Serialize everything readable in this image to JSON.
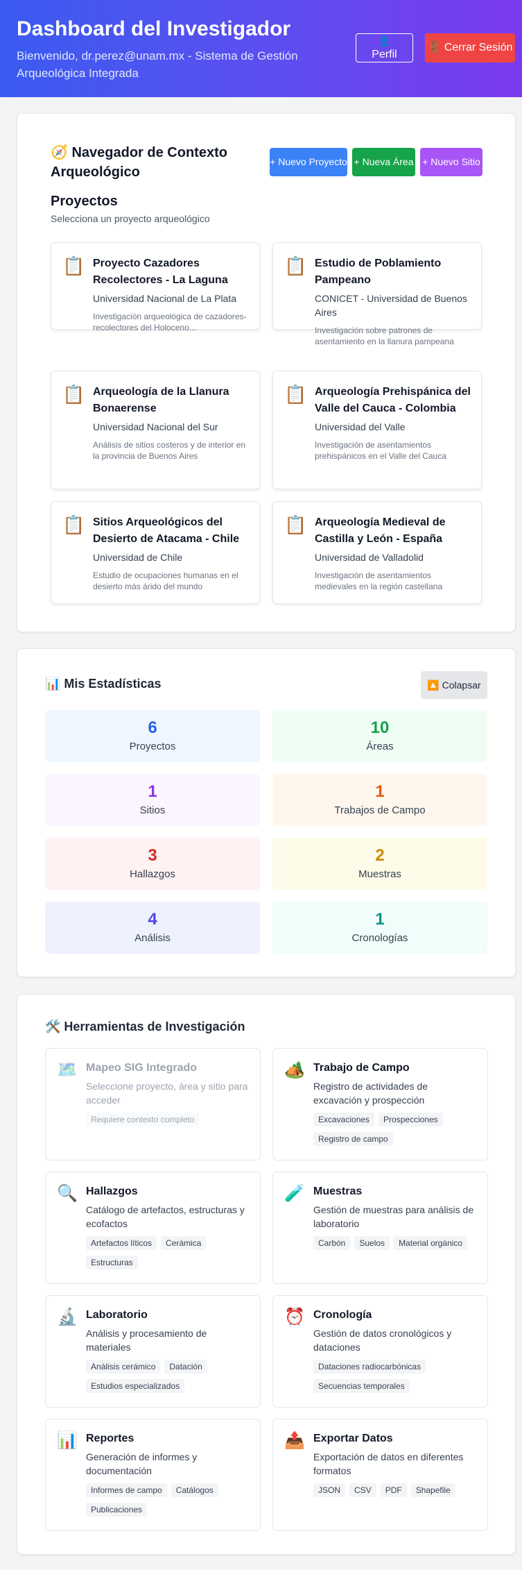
{
  "header": {
    "title": "Dashboard del Investigador",
    "subtitle": "Bienvenido, dr.perez@unam.mx - Sistema de Gestión Arqueológica Integrada",
    "profile_icon": "👤",
    "profile_label": "Perfil",
    "logout_icon": "🚪",
    "logout_label": "Cerrar Sesión"
  },
  "navigator": {
    "title": "🧭 Navegador de Contexto Arqueológico",
    "new_project": "+ Nuevo Proyecto",
    "new_area": "+ Nueva Área",
    "new_site": "+ Nuevo Sitio",
    "projects_heading": "Proyectos",
    "projects_sub": "Selecciona un proyecto arqueológico",
    "project_icon": "📋",
    "projects": [
      {
        "name": "Proyecto Cazadores Recolectores - La Laguna",
        "institution": "Universidad Nacional de La Plata",
        "description": "Investigación arqueológica de cazadores-recolectores del Holoceno..."
      },
      {
        "name": "Estudio de Poblamiento Pampeano",
        "institution": "CONICET - Universidad de Buenos Aires",
        "description": "Investigación sobre patrones de asentamiento en la llanura pampeana"
      },
      {
        "name": "Arqueología de la Llanura Bonaerense",
        "institution": "Universidad Nacional del Sur",
        "description": "Análisis de sitios costeros y de interior en la provincia de Buenos Aires"
      },
      {
        "name": "Arqueología Prehispánica del Valle del Cauca - Colombia",
        "institution": "Universidad del Valle",
        "description": "Investigación de asentamientos prehispánicos en el Valle del Cauca"
      },
      {
        "name": "Sitios Arqueológicos del Desierto de Atacama - Chile",
        "institution": "Universidad de Chile",
        "description": "Estudio de ocupaciones humanas en el desierto más árido del mundo"
      },
      {
        "name": "Arqueología Medieval de Castilla y León - España",
        "institution": "Universidad de Valladolid",
        "description": "Investigación de asentamientos medievales en la región castellana"
      }
    ]
  },
  "stats": {
    "title": "📊 Mis Estadísticas",
    "collapse_label": "🔼 Colapsar",
    "items": [
      {
        "value": "6",
        "label": "Proyectos",
        "color": "#2563eb",
        "bg": "#eff6ff"
      },
      {
        "value": "10",
        "label": "Áreas",
        "color": "#16a34a",
        "bg": "#f0fdf4"
      },
      {
        "value": "1",
        "label": "Sitios",
        "color": "#9333ea",
        "bg": "#faf5ff"
      },
      {
        "value": "1",
        "label": "Trabajos de Campo",
        "color": "#ea580c",
        "bg": "#fff7ed"
      },
      {
        "value": "3",
        "label": "Hallazgos",
        "color": "#dc2626",
        "bg": "#fef2f2"
      },
      {
        "value": "2",
        "label": "Muestras",
        "color": "#ca8a04",
        "bg": "#fefce8"
      },
      {
        "value": "4",
        "label": "Análisis",
        "color": "#4f46e5",
        "bg": "#eef2ff"
      },
      {
        "value": "1",
        "label": "Cronologías",
        "color": "#0d9488",
        "bg": "#f0fdfa"
      }
    ]
  },
  "tools": {
    "title": "🛠️ Herramientas de Investigación",
    "items": [
      {
        "icon": "🗺️",
        "name": "Mapeo SIG Integrado",
        "description": "Seleccione proyecto, área y sitio para acceder",
        "tags": [
          "Requiere contexto completo"
        ],
        "disabled": true
      },
      {
        "icon": "🏕️",
        "name": "Trabajo de Campo",
        "description": "Registro de actividades de excavación y prospección",
        "tags": [
          "Excavaciones",
          "Prospecciones",
          "Registro de campo"
        ]
      },
      {
        "icon": "🔍",
        "name": "Hallazgos",
        "description": "Catálogo de artefactos, estructuras y ecofactos",
        "tags": [
          "Artefactos líticos",
          "Cerámica",
          "Estructuras"
        ]
      },
      {
        "icon": "🧪",
        "name": "Muestras",
        "description": "Gestión de muestras para análisis de laboratorio",
        "tags": [
          "Carbón",
          "Suelos",
          "Material orgánico"
        ]
      },
      {
        "icon": "🔬",
        "name": "Laboratorio",
        "description": "Análisis y procesamiento de materiales",
        "tags": [
          "Análisis cerámico",
          "Datación",
          "Estudios especializados"
        ]
      },
      {
        "icon": "⏰",
        "name": "Cronología",
        "description": "Gestión de datos cronológicos y dataciones",
        "tags": [
          "Dataciones radiocarbónicas",
          "Secuencias temporales"
        ]
      },
      {
        "icon": "📊",
        "name": "Reportes",
        "description": "Generación de informes y documentación",
        "tags": [
          "Informes de campo",
          "Catálogos",
          "Publicaciones"
        ]
      },
      {
        "icon": "📤",
        "name": "Exportar Datos",
        "description": "Exportación de datos en diferentes formatos",
        "tags": [
          "JSON",
          "CSV",
          "PDF",
          "Shapefile"
        ]
      }
    ]
  }
}
